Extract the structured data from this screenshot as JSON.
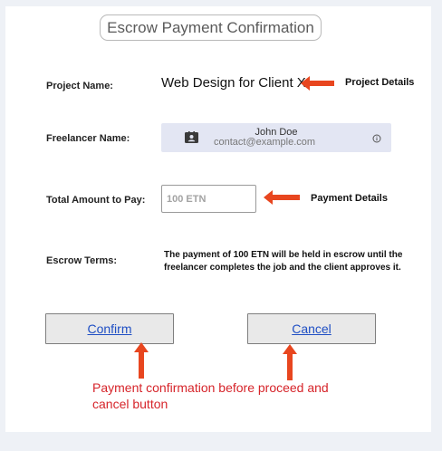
{
  "header": {
    "title": "Escrow Payment Confirmation"
  },
  "project": {
    "label": "Project Name:",
    "value": "Web Design for Client X",
    "annotation": "Project Details"
  },
  "freelancer": {
    "label": "Freelancer Name:",
    "name": "John Doe",
    "email": "contact@example.com"
  },
  "amount": {
    "label": "Total Amount to Pay:",
    "placeholder": "100 ETN",
    "annotation": "Payment Details"
  },
  "escrow": {
    "label": "Escrow Terms:",
    "text": "The payment of 100 ETN will be held in escrow until the freelancer completes the job and the client approves it."
  },
  "buttons": {
    "confirm_label": "Confirm",
    "cancel_label": "Cancel"
  },
  "note": "Payment confirmation before proceed and cancel button",
  "colors": {
    "arrow": "#e8461f",
    "note": "#d6242a",
    "link": "#1f4fc4",
    "card": "#e3e6f3"
  },
  "icons": [
    "contact-card-icon",
    "info-icon",
    "arrow-left-icon",
    "arrow-up-icon"
  ]
}
